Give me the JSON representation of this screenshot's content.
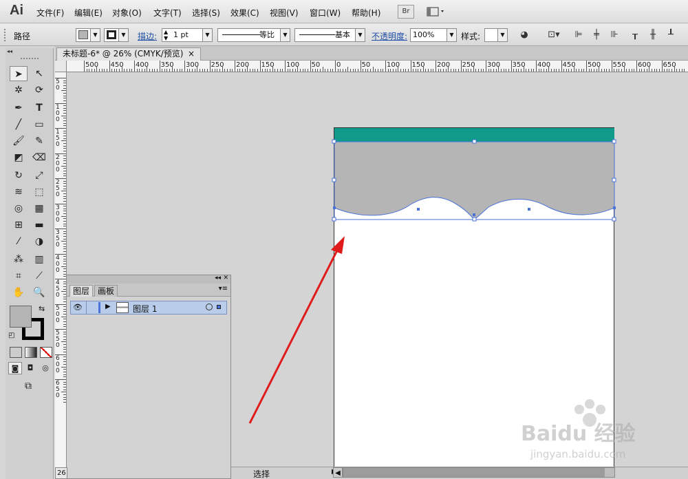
{
  "app": {
    "logo": "Ai"
  },
  "menu": [
    "文件(F)",
    "编辑(E)",
    "对象(O)",
    "文字(T)",
    "选择(S)",
    "效果(C)",
    "视图(V)",
    "窗口(W)",
    "帮助(H)"
  ],
  "menu_extra": {
    "bridge": "Br",
    "workspace_icon": "layout-icon"
  },
  "control": {
    "object_type": "路径",
    "stroke_label": "描边:",
    "stroke_weight": "1 pt",
    "profile_label": "等比",
    "brush_label": "基本",
    "opacity_label": "不透明度:",
    "opacity_value": "100%",
    "style_label": "样式:"
  },
  "document": {
    "tab_title": "未标题-6* @ 26% (CMYK/预览)",
    "close": "×"
  },
  "ruler": {
    "h_labels": [
      "500",
      "450",
      "400",
      "350",
      "300",
      "250",
      "200",
      "150",
      "100",
      "50",
      "0",
      "50",
      "100",
      "150",
      "200",
      "250",
      "300",
      "350",
      "400",
      "450",
      "500",
      "550",
      "600",
      "650"
    ],
    "v_labels": [
      "5\n0",
      "1\n0\n0",
      "1\n5\n0",
      "2\n0\n0",
      "2\n5\n0",
      "3\n0\n0",
      "3\n5\n0",
      "4\n0\n0",
      "4\n5\n0",
      "5\n0\n0",
      "5\n5\n0",
      "6\n0\n0",
      "6\n5\n0"
    ]
  },
  "colors": {
    "teal": "#0f9a8a",
    "gray_shape": "#b5b5b5",
    "arrow": "#e01b1b",
    "selection": "#4a72d8"
  },
  "layers_panel": {
    "tabs": [
      "图层",
      "画板"
    ],
    "layer_name": "图层 1",
    "collapse": "◂◂",
    "close": "✕",
    "menu": "▾≡"
  },
  "status": {
    "tool_name": "选择",
    "zoom_fragment": "26"
  },
  "watermark": {
    "brand": "Baidu 经验",
    "url": "jingyan.baidu.com"
  }
}
